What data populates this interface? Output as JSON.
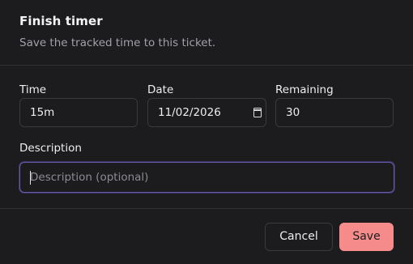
{
  "dialog": {
    "title": "Finish timer",
    "subtitle": "Save the tracked time to this ticket."
  },
  "fields": {
    "time": {
      "label": "Time",
      "value": "15m"
    },
    "date": {
      "label": "Date",
      "value": "11/02/2026",
      "icon": "calendar-icon"
    },
    "remaining": {
      "label": "Remaining",
      "value": "30"
    },
    "description": {
      "label": "Description",
      "placeholder": "Description (optional)",
      "value": ""
    }
  },
  "actions": {
    "cancel_label": "Cancel",
    "save_label": "Save"
  },
  "colors": {
    "background": "#1c1c1e",
    "accent": "#f58b8b",
    "focus_ring": "#6a5aa6",
    "border": "#3a3a3e"
  }
}
